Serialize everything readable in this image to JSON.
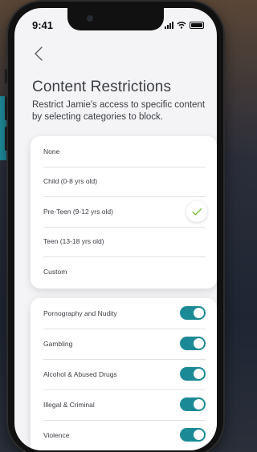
{
  "status_bar": {
    "time": "9:41"
  },
  "page": {
    "title": "Content Restrictions",
    "subtitle": "Restrict Jamie's access to specific content by selecting categories to block."
  },
  "age_options": [
    {
      "label": "None",
      "selected": false
    },
    {
      "label": "Child (0-8 yrs old)",
      "selected": false
    },
    {
      "label": "Pre-Teen (9-12 yrs old)",
      "selected": true
    },
    {
      "label": "Teen (13-18 yrs old)",
      "selected": false
    },
    {
      "label": "Custom",
      "selected": false
    }
  ],
  "categories": [
    {
      "label": "Pornography and Nudity",
      "enabled": true
    },
    {
      "label": "Gambling",
      "enabled": true
    },
    {
      "label": "Alcohol & Abused Drugs",
      "enabled": true
    },
    {
      "label": "Illegal & Criminal",
      "enabled": true
    },
    {
      "label": "Violence",
      "enabled": true
    }
  ],
  "colors": {
    "accent": "#1b8a96",
    "check": "#7cc243",
    "text": "#3b3e44"
  },
  "icons": {
    "back": "chevron-left-icon",
    "check": "checkmark-icon"
  }
}
